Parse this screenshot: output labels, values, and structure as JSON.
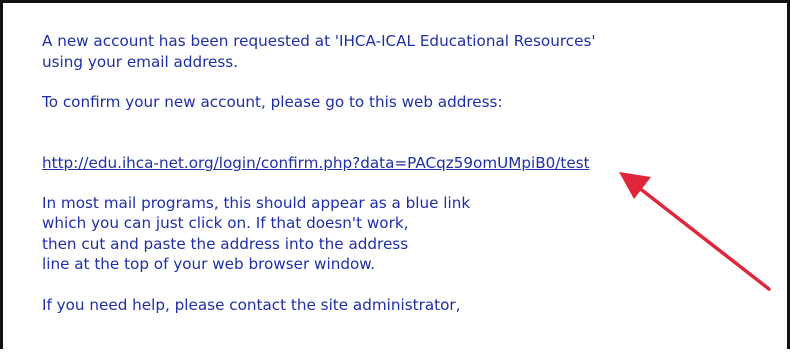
{
  "email": {
    "intro": "A new account has been requested at 'IHCA-ICAL Educational Resources'\nusing your email address.",
    "confirm_prompt": "To confirm your new account, please go to this web address:",
    "confirm_link": "http://edu.ihca-net.org/login/confirm.php?data=PACqz59omUMpiB0/test",
    "instructions": "In most mail programs, this should appear as a blue link\nwhich you can just click on. If that doesn't work,\nthen cut and paste the address into the address\nline at the top of your web browser window.",
    "help": "If you need help, please contact the site administrator,"
  },
  "annotation": {
    "arrow_color": "#e0263a",
    "arrow_icon": "red-arrow-icon"
  }
}
